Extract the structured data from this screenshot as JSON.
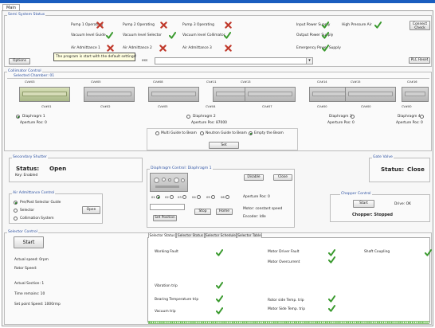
{
  "main_tab": "Main",
  "semi_system_status": {
    "title": "Semi System Status",
    "items": [
      {
        "label": "Pump 1 Operating",
        "ok": false
      },
      {
        "label": "Pump 2 Operating",
        "ok": false
      },
      {
        "label": "Pump 3 Operating",
        "ok": false
      },
      {
        "label": "Input Power Supply",
        "ok": true
      },
      {
        "label": "High Pressure Air",
        "ok": true
      },
      {
        "label": "Vacuum level Guide",
        "ok": true
      },
      {
        "label": "Vacuum level Selector",
        "ok": true
      },
      {
        "label": "Vacuum level Collimator",
        "ok": true
      },
      {
        "label": "Output Power Supply",
        "ok": true
      },
      {
        "label": "Air Admittance 1",
        "ok": false
      },
      {
        "label": "Air Admittance 2",
        "ok": false
      },
      {
        "label": "Air Admittance 3",
        "ok": false
      },
      {
        "label": "Emergency Power Supply",
        "ok": true
      }
    ],
    "connect_check": "Connect Check",
    "options": "Options",
    "plc_reset": "PLC Reset",
    "tooltip": "The program is start with the default settings!",
    "dropdown_caption": "ess"
  },
  "collimator": {
    "title": "Collimator Control",
    "selected_chamber": "Selected Chamber: 01",
    "top_labels": [
      "CV#03",
      "CV#05",
      "CV#08",
      "CV#11",
      "CV#13",
      "CV#14",
      "CV#15",
      "CV#16"
    ],
    "bottom_labels": [
      "CV#01",
      "CV#02",
      "CV#05",
      "CV#04",
      "CV#07",
      "CV#00",
      "CV#00",
      "CV#00"
    ],
    "diaphragms": [
      {
        "label": "Diaphragm 1",
        "aperture": "Aperture Pos: 0",
        "selected": true
      },
      {
        "label": "Diaphragm 2",
        "aperture": "Aperture Pos: 87000",
        "selected": false
      },
      {
        "label": "Diaphragm 3",
        "aperture": "Aperture Pos: 0",
        "selected": false
      },
      {
        "label": "Diaphragm 4",
        "aperture": "Aperture Pos: 0",
        "selected": false
      }
    ],
    "beam_options": [
      "Multi Guide to Beam",
      "Neutron Guide to Beam",
      "Empty the Beam"
    ],
    "beam_selected": 2,
    "set": "Set"
  },
  "secondary_shutter": {
    "title": "Secondary Shutter",
    "status_label": "Status:",
    "status_value": "Open",
    "key": "Key: Enabled"
  },
  "diaphragm_control": {
    "title": "Diaphragm Control: Diaphragm 1",
    "disable": "Disable",
    "close": "Close",
    "slots": [
      "01",
      "02",
      "03",
      "04",
      "05",
      "06"
    ],
    "aperture_pos": "Aperture Pos: 0",
    "motor": "Motor: constant speed",
    "encoder": "Encoder: Idle",
    "stop": "Stop",
    "home": "Home",
    "set_position": "Set Position"
  },
  "gate_valve": {
    "title": "Gate Valve",
    "status_label": "Status:",
    "status_value": "Close"
  },
  "air_admittance": {
    "title": "Air Admittance Control",
    "options": [
      "Pre/Post Selector Guide",
      "Selector",
      "Collimation System"
    ],
    "selected": 0,
    "open": "Open"
  },
  "chopper": {
    "title": "Chopper Control",
    "start": "Start",
    "drive": "Drive: OK",
    "status": "Chopper: Stopped"
  },
  "selector_control": {
    "title": "Selector Control",
    "start": "Start",
    "actual_speed": "Actual speed: 0rpm",
    "rotor_speed": "Rotor Speed:",
    "actual_section": "Actual Section: 1",
    "time_remains": "Time remains: 10",
    "set_point_speed": "Set point Speed: 1000rmp"
  },
  "selector_tabs": [
    "Selector Status",
    "Selector Status",
    "Selector Schedule",
    "Selector Table"
  ],
  "selector_status": {
    "items": [
      {
        "label": "Working Fault",
        "ok": true
      },
      {
        "label": "Motor Driver Fault",
        "ok": true
      },
      {
        "label": "Shaft Coupling",
        "ok": true
      },
      {
        "label": "Motor Overcurrent",
        "ok": true
      },
      {
        "label": "Vibration trip",
        "ok": true
      },
      {
        "label": "Bearing Temperature trip",
        "ok": true
      },
      {
        "label": "Rotor side Temp. trip",
        "ok": true
      },
      {
        "label": "Vacuum trip",
        "ok": true
      },
      {
        "label": "Motor Side Temp. trip",
        "ok": true
      }
    ]
  }
}
